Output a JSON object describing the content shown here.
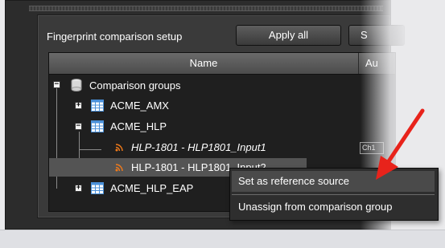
{
  "setup": {
    "label": "Fingerprint comparison setup",
    "apply_all_button": "Apply all",
    "second_button": "S"
  },
  "table": {
    "columns": [
      "Name",
      "Au"
    ],
    "tree": {
      "root": "Comparison groups",
      "group_amx": "ACME_AMX",
      "group_hlp": "ACME_HLP",
      "source_1": "HLP-1801 - HLP1801_Input1",
      "source_2": "HLP-1801 - HLP1801_Input2",
      "group_hlp_eap": "ACME_HLP_EAP",
      "source_1_tag": "Ch1"
    }
  },
  "context_menu": {
    "items": [
      "Set as reference source",
      "Unassign from comparison group"
    ]
  },
  "colors": {
    "annotation_arrow": "#e8231b",
    "rss_icon": "#f07a1a",
    "table_icon": "#4a90d9"
  }
}
